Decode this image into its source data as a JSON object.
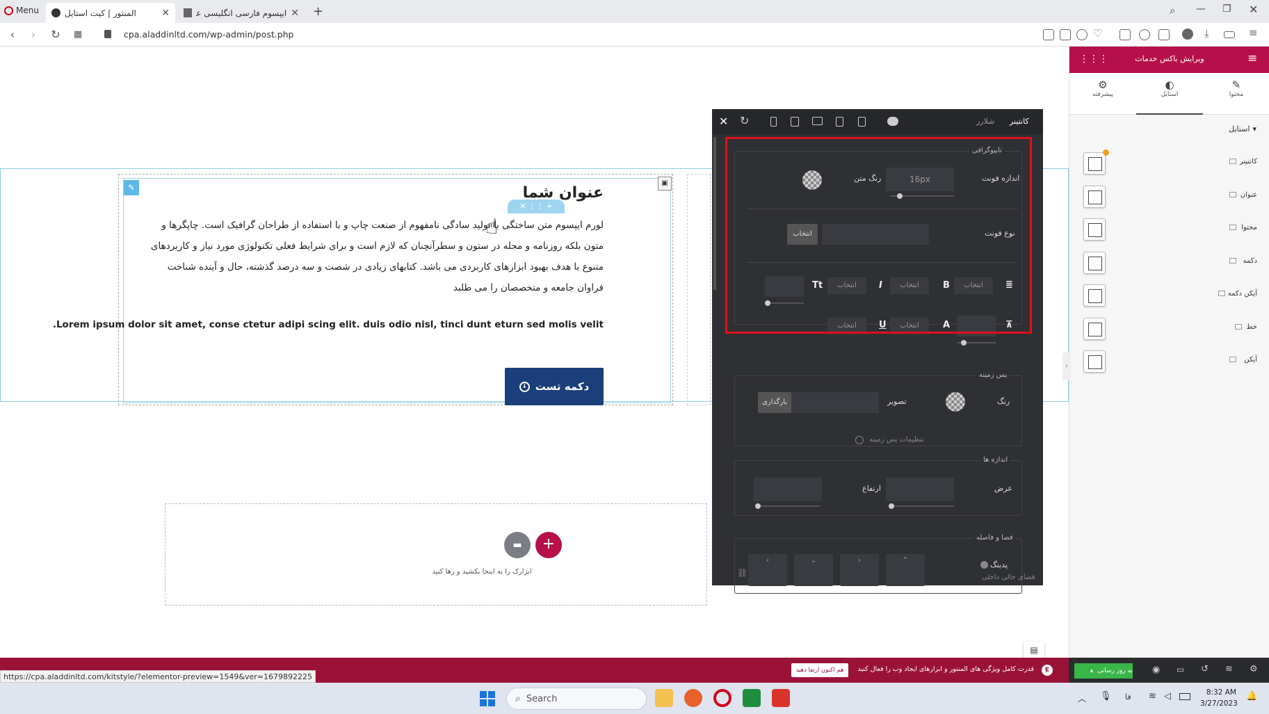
{
  "browser": {
    "menu_label": "Menu",
    "tabs": [
      {
        "label": "المنتور | کیت استایل"
      },
      {
        "label": "ایپسوم فارسی انگلیسی عربی | ..."
      }
    ],
    "new_tab": "+",
    "url": "cpa.aladdinltd.com/wp-admin/post.php",
    "status_url": "https://cpa.aladdinltd.com/kitstyle/?elementor-preview=1549&ver=1679892225"
  },
  "canvas": {
    "heading": "عنوان شما",
    "paragraph_lines": [
      "لورم ایپسوم متن ساختگی با تولید سادگی نامفهوم از صنعت چاپ و با استفاده از طراحان گرافیک است. چاپگرها و",
      "متون بلکه روزنامه و مجله در ستون و سطرآنچنان که لازم است و برای شرایط فعلی تکنولوژی مورد نیاز و کاربردهای",
      "متنوع با هدف بهبود ابزارهای کاربردی می باشد. کتابهای زیادی در شصت و سه درصد گذشته، حال و آینده شناخت",
      "فراوان جامعه و متخصصان را می طلبد"
    ],
    "lorem_en": "Lorem ipsum dolor sit amet, conse ctetur adipi scing elit. duis odio nisl, tinci dunt eturn sed molis velit.",
    "button_label": "دکمه تست",
    "dropzone_text": "ابزارک را به اینجا بکشید و رها کنید"
  },
  "panel": {
    "tab_container": "کانتینر",
    "tab_other": "شلارر",
    "typography": {
      "legend": "تایپوگرافی",
      "font_size_label": "اندازه فونت",
      "font_size_value": "16px",
      "text_color_label": "رنگ متن",
      "font_family_label": "نوع فونت",
      "select_label": "انتخاب"
    },
    "background": {
      "legend": "پس زمینه",
      "color_label": "رنگ",
      "image_label": "تصویر",
      "upload_label": "بارگذاری",
      "settings_label": "تنظیمات پس زمینه"
    },
    "dimensions": {
      "legend": "اندازه ها",
      "width_label": "عرض",
      "height_label": "ارتفاع"
    },
    "spacing": {
      "legend": "فضا و فاصله",
      "padding_label": "پدینگ",
      "inner_label": "فضای خالی داخلی"
    }
  },
  "sidebar": {
    "title": "ویرایش باکس خدمات",
    "tabs": [
      {
        "label": "محتوا",
        "icon": "pencil-icon"
      },
      {
        "label": "استایل",
        "icon": "contrast-icon"
      },
      {
        "label": "پیشرفته",
        "icon": "gear-icon"
      }
    ],
    "section_title": "استایل",
    "items": [
      {
        "label": "کانتینر"
      },
      {
        "label": "عنوان"
      },
      {
        "label": "محتوا"
      },
      {
        "label": "دکمه"
      },
      {
        "label": "آیکن دکمه"
      },
      {
        "label": "خط"
      },
      {
        "label": "آیکن"
      }
    ],
    "save_label": "به روز رسانی"
  },
  "notice": {
    "text": "قدرت کامل ویژگی های المنتور و ابزارهای ایجاد وب را فعال کنید",
    "button": "هم اکنون ارتقا دهید"
  },
  "taskbar": {
    "search_placeholder": "Search",
    "time": "8:32 AM",
    "date": "3/27/2023",
    "lang": "فا"
  },
  "colors": {
    "accent": "#b5104a",
    "button": "#1b3f7a",
    "highlight": "#e0101a"
  }
}
